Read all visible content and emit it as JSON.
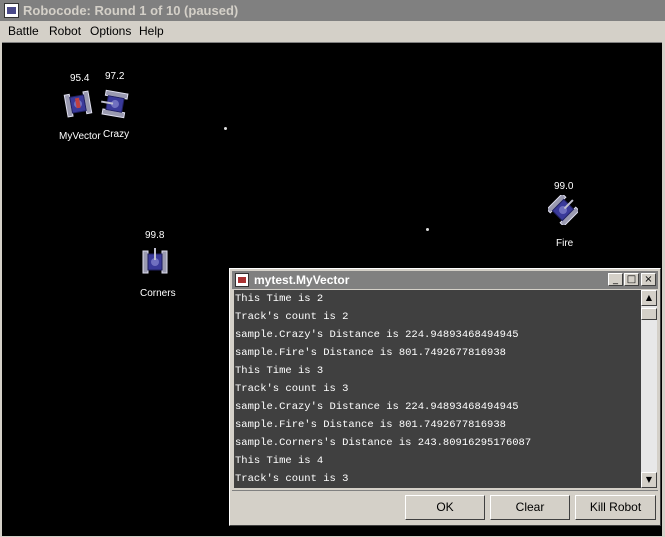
{
  "window": {
    "title": "Robocode: Round 1 of 10 (paused)"
  },
  "menubar": {
    "items": [
      "Battle",
      "Robot",
      "Options",
      "Help"
    ]
  },
  "robots": {
    "myvector": {
      "name": "MyVector",
      "energy": "95.4"
    },
    "crazy": {
      "name": "Crazy",
      "energy": "97.2"
    },
    "fire": {
      "name": "Fire",
      "energy": "99.0"
    },
    "corners": {
      "name": "Corners",
      "energy": "99.8"
    }
  },
  "console": {
    "title": "mytest.MyVector",
    "lines": [
      "This Time is 2",
      "Track's count is 2",
      "sample.Crazy's Distance is 224.94893468494945",
      "sample.Fire's Distance is 801.7492677816938",
      "This Time is 3",
      "Track's count is 3",
      "sample.Crazy's Distance is 224.94893468494945",
      "sample.Fire's Distance is 801.7492677816938",
      "sample.Corners's Distance is 243.80916295176087",
      "This Time is 4",
      "Track's count is 3"
    ],
    "buttons": {
      "ok": "OK",
      "clear": "Clear",
      "kill": "Kill Robot"
    }
  },
  "colors": {
    "arena": "#000000",
    "console_bg": "#404040",
    "robot_body": "#3a3a9a",
    "robot_tread": "#9a9ab0"
  }
}
